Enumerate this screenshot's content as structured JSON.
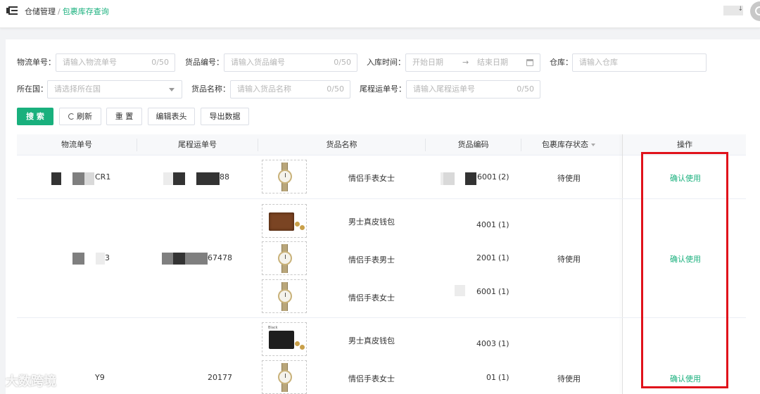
{
  "header": {
    "breadcrumb_parent": "仓储管理",
    "breadcrumb_sep": "/",
    "breadcrumb_current": "包裹库存查询",
    "user_suffix": "↓"
  },
  "filters": {
    "logistics_no": {
      "label": "物流单号：",
      "placeholder": "请输入物流单号",
      "count": "0/50"
    },
    "goods_no": {
      "label": "货品编号：",
      "placeholder": "请输入货品编号",
      "count": "0/50"
    },
    "in_time": {
      "label": "入库时间：",
      "start_placeholder": "开始日期",
      "arrow": "→",
      "end_placeholder": "结束日期"
    },
    "warehouse": {
      "label": "仓库：",
      "placeholder": "请输入仓库"
    },
    "country": {
      "label": "所在国：",
      "placeholder": "请选择所在国"
    },
    "goods_name": {
      "label": "货品名称：",
      "placeholder": "请输入货品名称",
      "count": "0/50"
    },
    "tail_no": {
      "label": "尾程运单号：",
      "placeholder": "请输入尾程运单号",
      "count": "0/50"
    }
  },
  "buttons": {
    "search": "搜 索",
    "refresh": "刷新",
    "reset": "重 置",
    "edit_header": "编辑表头",
    "export": "导出数据"
  },
  "table": {
    "headers": {
      "logistics_no": "物流单号",
      "tail_no": "尾程运单号",
      "goods_name": "货品名称",
      "goods_code": "货品编码",
      "status": "包裹库存状态",
      "action": "操作"
    },
    "rows": [
      {
        "logistics_suffix": "CR1",
        "tail_suffix": "88",
        "status": "待使用",
        "action": "确认使用",
        "items": [
          {
            "image": "watch-icon",
            "name": "情侣手表女士",
            "code_suffix": "6001",
            "qty": "(2)"
          }
        ]
      },
      {
        "logistics_suffix": "3",
        "tail_suffix": "67478",
        "status": "待使用",
        "action": "确认使用",
        "items": [
          {
            "image": "wallet-icon",
            "name": "男士真皮钱包",
            "code_suffix": "4001",
            "qty": "(1)"
          },
          {
            "image": "watch-icon",
            "name": "情侣手表男士",
            "code_suffix": "2001",
            "qty": "(1)"
          },
          {
            "image": "watch-icon",
            "name": "情侣手表女士",
            "code_suffix": "6001",
            "qty": "(1)"
          }
        ]
      },
      {
        "logistics_suffix": "Y9",
        "tail_suffix": "20177",
        "status": "待使用",
        "action": "确认使用",
        "items": [
          {
            "image": "wallet-icon",
            "name": "男士真皮钱包",
            "code_suffix": "4003",
            "qty": "(1)"
          },
          {
            "image": "watch-icon",
            "name": "情侣手表女士",
            "code_suffix": "01",
            "qty": "(1)"
          }
        ]
      }
    ]
  },
  "colors": {
    "accent": "#19b07d",
    "highlight": "#e0121b"
  },
  "watermark": "大数跨境"
}
